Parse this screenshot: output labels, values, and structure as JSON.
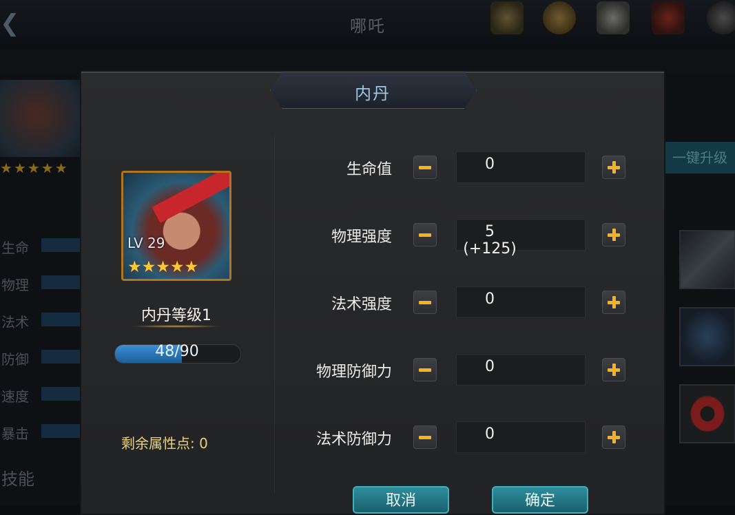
{
  "background": {
    "title": "哪吒",
    "upgrade_label": "一键升级",
    "stats": [
      "生命",
      "物理",
      "法术",
      "防御",
      "速度",
      "暴击"
    ],
    "section": "技能"
  },
  "dialog": {
    "title": "内丹",
    "hero": {
      "level": "LV 29",
      "stars": "★★★★★"
    },
    "stage_name": "内丹等级1",
    "xp": {
      "text": "48/90",
      "current": 48,
      "max": 90
    },
    "remaining_points": "剩余属性点: 0",
    "stats": [
      {
        "label": "生命值",
        "value": "0"
      },
      {
        "label": "物理强度",
        "value": "5 (+125)"
      },
      {
        "label": "法术强度",
        "value": "0"
      },
      {
        "label": "物理防御力",
        "value": "0"
      },
      {
        "label": "法术防御力",
        "value": "0"
      }
    ],
    "cancel_label": "取消",
    "confirm_label": "确定"
  },
  "colors": {
    "accent": "#f5b324",
    "title_text": "#9ec6e6",
    "xp_fill": "#3e8ed4",
    "action_button": "#2d8e9c",
    "points_text": "#e8d27a"
  }
}
